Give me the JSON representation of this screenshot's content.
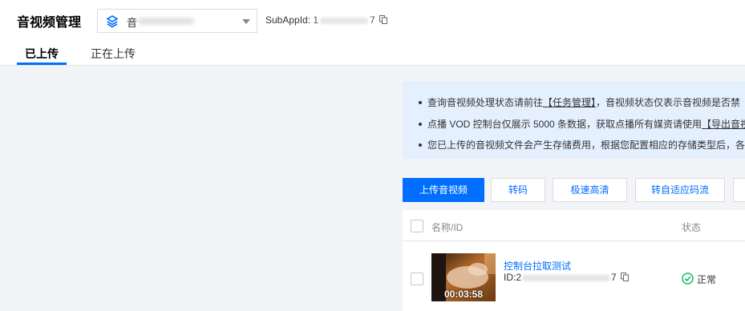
{
  "header": {
    "title": "音视频管理",
    "app_select": {
      "value": "音"
    },
    "subapp": {
      "label": "SubAppId: ",
      "id_prefix": "1",
      "id_suffix": "7"
    }
  },
  "tabs": [
    {
      "label": "已上传",
      "active": true
    },
    {
      "label": "正在上传",
      "active": false
    }
  ],
  "notice": {
    "items": [
      {
        "pre": "查询音视频处理状态请前往",
        "link": "【任务管理】",
        "post": "，音视频状态仅表示音视频是否禁"
      },
      {
        "pre": "点播 VOD 控制台仅展示 5000 条数据，获取点播所有媒资请使用",
        "link": "【导出音视",
        "post": ""
      },
      {
        "pre": "您已上传的音视频文件会产生存储费用，根据您配置相应的存储类型后，各",
        "link": "",
        "post": ""
      }
    ]
  },
  "toolbar": {
    "upload_label": "上传音视频",
    "transcode_label": "转码",
    "speed_hd_label": "极速高清",
    "adaptive_label": "转自适应码流"
  },
  "table": {
    "headers": {
      "name": "名称/ID",
      "status": "状态"
    },
    "rows": [
      {
        "name": "控制台拉取测试",
        "id_prefix": "ID:2",
        "id_suffix": "7",
        "duration": "00:03:58",
        "status": "正常"
      }
    ]
  },
  "colors": {
    "primary": "#006eff",
    "success": "#0abf5b",
    "notice_bg": "#e5f0ff"
  }
}
